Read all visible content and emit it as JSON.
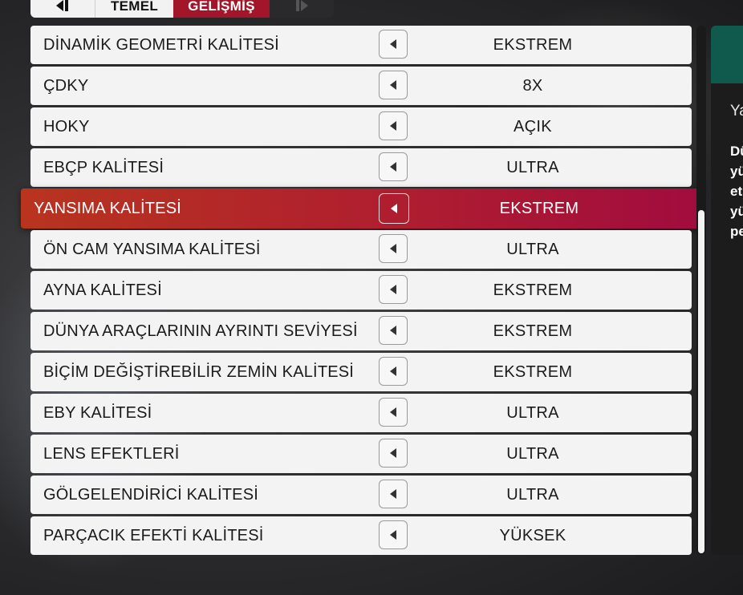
{
  "tabs": {
    "left_icon": "tab-prev-icon",
    "basic_label": "TEMEL",
    "advanced_label": "GELİŞMİŞ",
    "right_icon": "tab-next-icon"
  },
  "settings": [
    {
      "label": "DİNAMİK GEOMETRİ KALİTESİ",
      "value": "EKSTREM",
      "selected": false
    },
    {
      "label": "ÇDKY",
      "value": "8X",
      "selected": false
    },
    {
      "label": "HOKY",
      "value": "AÇIK",
      "selected": false
    },
    {
      "label": "EBÇP KALİTESİ",
      "value": "ULTRA",
      "selected": false
    },
    {
      "label": "YANSIMA KALİTESİ",
      "value": "EKSTREM",
      "selected": true
    },
    {
      "label": "ÖN CAM YANSIMA KALİTESİ",
      "value": "ULTRA",
      "selected": false
    },
    {
      "label": "AYNA KALİTESİ",
      "value": "EKSTREM",
      "selected": false
    },
    {
      "label": "DÜNYA ARAÇLARININ AYRINTI SEVİYESİ",
      "value": "EKSTREM",
      "selected": false
    },
    {
      "label": "BİÇİM DEĞİŞTİREBİLİR ZEMİN KALİTESİ",
      "value": "EKSTREM",
      "selected": false
    },
    {
      "label": "EBY KALİTESİ",
      "value": "ULTRA",
      "selected": false
    },
    {
      "label": "LENS EFEKTLERİ",
      "value": "ULTRA",
      "selected": false
    },
    {
      "label": "GÖLGELENDİRİCİ KALİTESİ",
      "value": "ULTRA",
      "selected": false
    },
    {
      "label": "PARÇACIK EFEKTİ KALİTESİ",
      "value": "YÜKSEK",
      "selected": false
    }
  ],
  "side_panel": {
    "title_partial": "Ya",
    "desc_partial": [
      "Dü",
      "yü",
      "et",
      "yü",
      "pe"
    ]
  },
  "colors": {
    "selected_start": "#b8341f",
    "selected_end": "#a10c3e",
    "active_tab": "#a3162a",
    "side_header": "#0f5a4c"
  }
}
